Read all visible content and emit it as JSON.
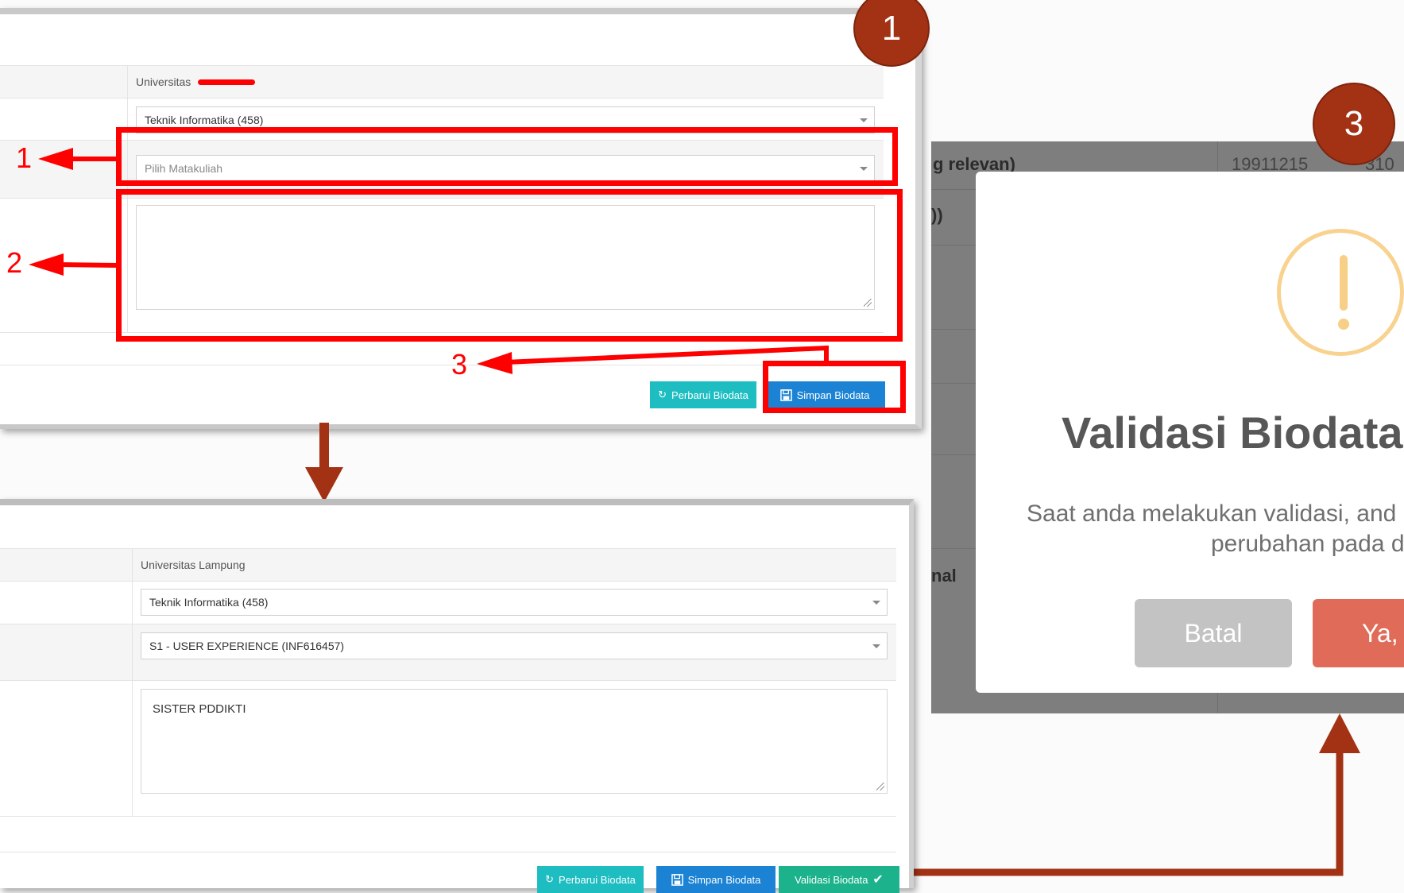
{
  "colors": {
    "annotation_red": "#ff0000",
    "callout_brown": "#a33215",
    "button_cyan": "#1ebdc2",
    "button_blue": "#1c83d4",
    "button_green": "#1bb28c",
    "modal_cancel": "#c3c3c3",
    "modal_confirm": "#df6b58",
    "warning": "#f8d28e"
  },
  "form_top": {
    "university_label": "Universitas",
    "prodi_value": "Teknik Informatika (458)",
    "matakuliah_placeholder": "Pilih Matakuliah",
    "textarea_value": "",
    "btn_perbarui": "Perbarui Biodata",
    "btn_simpan": "Simpan Biodata"
  },
  "form_bottom": {
    "university_label": "Universitas Lampung",
    "prodi_value": "Teknik Informatika (458)",
    "matakuliah_value": "S1 - USER EXPERIENCE (INF616457)",
    "textarea_value": "SISTER PDDIKTI",
    "btn_perbarui": "Perbarui Biodata",
    "btn_simpan": "Simpan Biodata",
    "btn_validasi": "Validasi Biodata"
  },
  "annotations": {
    "label_1": "1",
    "label_2": "2",
    "label_3": "3",
    "circle_1": "1",
    "circle_3": "3"
  },
  "modal_background": {
    "row1_label": "g relevan)",
    "row1_value": "19911215",
    "row1_value_tail": "310",
    "row2_label": "))",
    "row3_label": "nal"
  },
  "modal": {
    "title": "Validasi Biodata",
    "text_line1": "Saat anda melakukan validasi, and",
    "text_line2": "perubahan pada d",
    "cancel_label": "Batal",
    "confirm_label": "Ya,"
  }
}
